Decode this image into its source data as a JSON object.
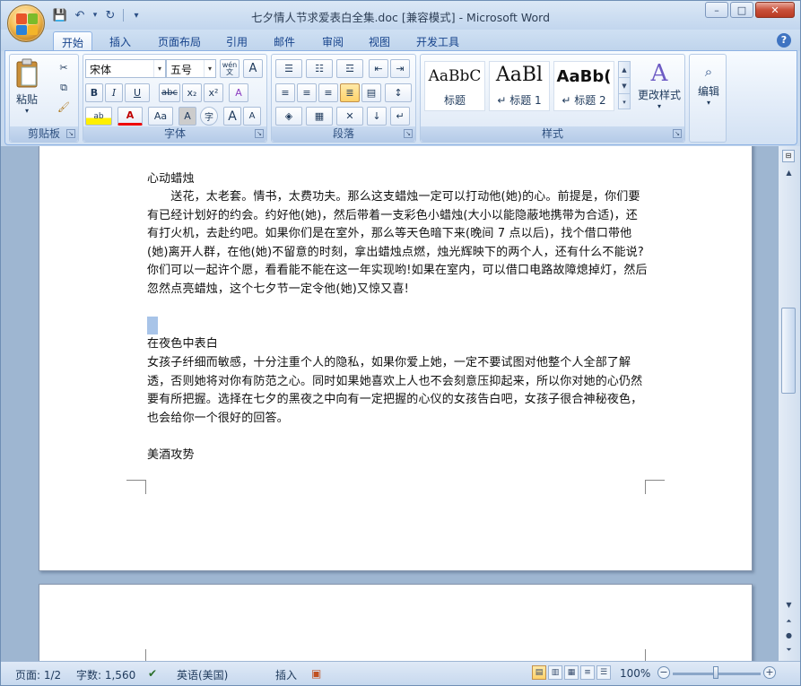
{
  "window": {
    "title": "七夕情人节求爱表白全集.doc [兼容模式] - Microsoft Word",
    "controls": {
      "minimize": "–",
      "maximize": "□",
      "close": "✕"
    }
  },
  "qat": {
    "save": "💾",
    "undo": "↶",
    "redo": "↻",
    "more": "▾"
  },
  "tabs": [
    "开始",
    "插入",
    "页面布局",
    "引用",
    "邮件",
    "审阅",
    "视图",
    "开发工具"
  ],
  "help": "?",
  "ribbon": {
    "clipboard": {
      "label": "剪贴板",
      "paste": "粘贴",
      "paste_arrow": "▾"
    },
    "font": {
      "label": "字体",
      "font_name": "宋体",
      "font_size": "五号",
      "wen": "wén\n文",
      "A_box": "A",
      "bold": "B",
      "italic": "I",
      "underline": "U",
      "strike": "abc",
      "sub": "x₂",
      "sup": "x²",
      "clear": "A",
      "highlight": "ab",
      "font_color": "A",
      "change_case": "Aa",
      "char_shade": "A",
      "enclose": "字",
      "grow": "A",
      "shrink": "A"
    },
    "paragraph": {
      "label": "段落"
    },
    "styles": {
      "label": "样式",
      "items": [
        {
          "sample": "AaBbC",
          "name": "标题"
        },
        {
          "sample": "AaBl",
          "name": "↵ 标题 1"
        },
        {
          "sample": "AaBb(",
          "name": "↵ 标题 2"
        }
      ],
      "change_styles": "更改样式"
    },
    "editing": {
      "label": "编辑"
    }
  },
  "document": {
    "section1_title": "心动蜡烛",
    "section1_body": "　　送花，太老套。情书，太费功夫。那么这支蜡烛一定可以打动他(她)的心。前提是，你们要有已经计划好的约会。约好他(她)，然后带着一支彩色小蜡烛(大小以能隐蔽地携带为合适)，还有打火机，去赴约吧。如果你们是在室外，那么等天色暗下来(晚间 7 点以后)，找个借口带他(她)离开人群，在他(她)不留意的时刻，拿出蜡烛点燃，烛光辉映下的两个人，还有什么不能说?你们可以一起许个愿，看看能不能在这一年实现哟!如果在室内，可以借口电路故障熄掉灯，然后忽然点亮蜡烛，这个七夕节一定令他(她)又惊又喜!",
    "section2_title": "在夜色中表白",
    "section2_body": "女孩子纤细而敏感，十分注重个人的隐私，如果你爱上她，一定不要试图对他整个人全部了解透，否则她将对你有防范之心。同时如果她喜欢上人也不会刻意压抑起来，所以你对她的心仍然要有所把握。选择在七夕的黑夜之中向有一定把握的心仪的女孩告白吧，女孩子很合神秘夜色，也会给你一个很好的回答。",
    "section3_title": "美酒攻势"
  },
  "status": {
    "page": "页面: 1/2",
    "words": "字数: 1,560",
    "language": "英语(美国)",
    "insert": "插入",
    "zoom": "100%",
    "zoom_value": 100
  }
}
